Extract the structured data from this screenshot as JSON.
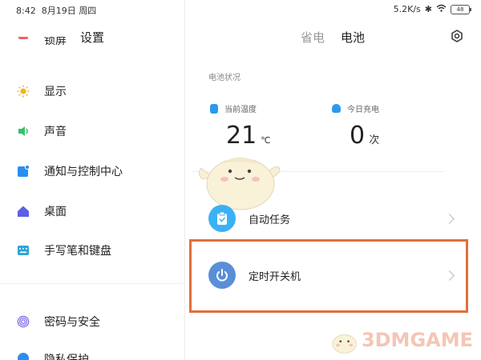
{
  "status_bar": {
    "time": "8:42",
    "date": "8月19日 周四",
    "net_speed": "5.2K/s",
    "battery": "48"
  },
  "left": {
    "title": "设置",
    "items": [
      {
        "label": "锁屏",
        "icon": "lock-screen-icon",
        "color": "#f06262"
      },
      {
        "label": "显示",
        "icon": "sun-icon",
        "color": "#f5b21c"
      },
      {
        "label": "声音",
        "icon": "speaker-icon",
        "color": "#33c26b"
      },
      {
        "label": "通知与控制中心",
        "icon": "notification-icon",
        "color": "#2a8df0"
      },
      {
        "label": "桌面",
        "icon": "home-icon",
        "color": "#5b5fe8"
      },
      {
        "label": "手写笔和键盘",
        "icon": "keyboard-icon",
        "color": "#2aa5d8"
      },
      {
        "label": "密码与安全",
        "icon": "fingerprint-icon",
        "color": "#7a6ae6"
      },
      {
        "label": "隐私保护",
        "icon": "privacy-icon",
        "color": "#2a8df0"
      }
    ]
  },
  "right": {
    "tabs": [
      "省电",
      "电池"
    ],
    "section_label": "电池状况",
    "temp_label": "当前温度",
    "temp_value": "21",
    "temp_unit": "℃",
    "charge_label": "今日充电",
    "charge_value": "0",
    "charge_unit": "次",
    "rows": [
      {
        "label": "自动任务",
        "icon": "clipboard-check-icon",
        "color": "#3bb1f5"
      },
      {
        "label": "定时开关机",
        "icon": "power-icon",
        "color": "#4a8fe0"
      }
    ]
  },
  "watermark": {
    "text": "3DMGAME"
  }
}
